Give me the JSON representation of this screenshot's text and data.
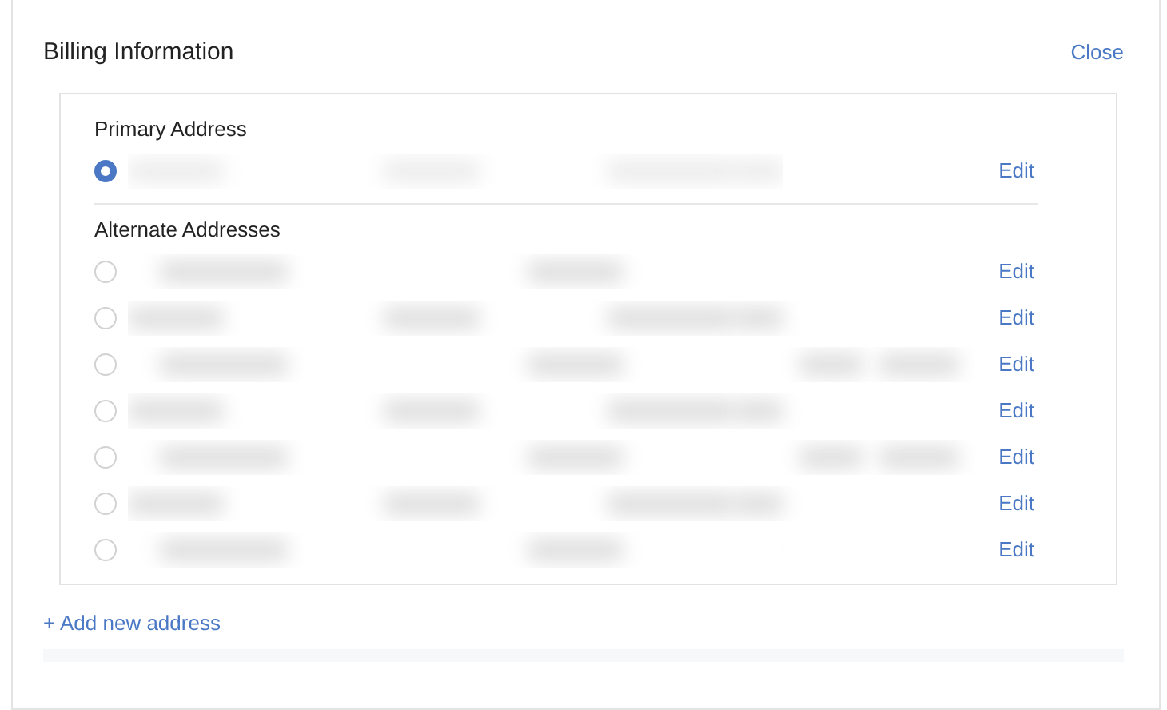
{
  "panel": {
    "title": "Billing Information",
    "close": "Close"
  },
  "primary": {
    "heading": "Primary Address",
    "rows": [
      {
        "selected": true,
        "edit": "Edit"
      }
    ]
  },
  "alternate": {
    "heading": "Alternate Addresses",
    "rows": [
      {
        "selected": false,
        "edit": "Edit"
      },
      {
        "selected": false,
        "edit": "Edit"
      },
      {
        "selected": false,
        "edit": "Edit"
      },
      {
        "selected": false,
        "edit": "Edit"
      },
      {
        "selected": false,
        "edit": "Edit"
      },
      {
        "selected": false,
        "edit": "Edit"
      },
      {
        "selected": false,
        "edit": "Edit"
      }
    ]
  },
  "add_link": "+ Add new address"
}
